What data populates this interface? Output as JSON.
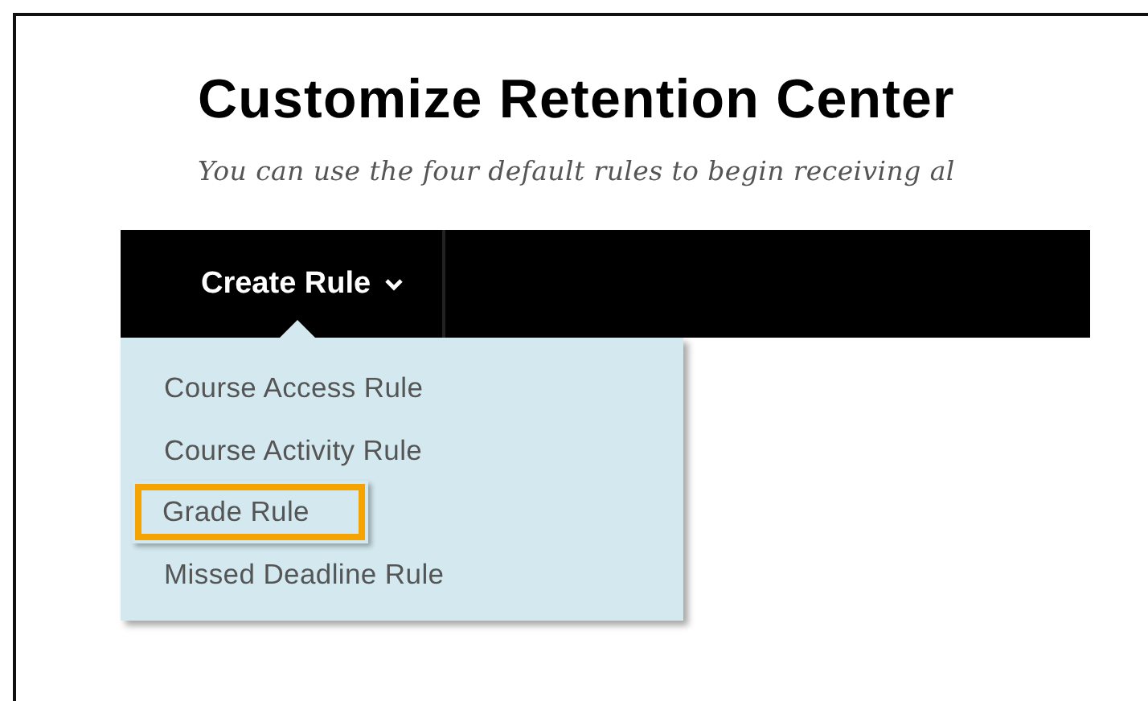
{
  "page": {
    "title": "Customize Retention Center",
    "subtitle": "You can use the four default rules to begin receiving al"
  },
  "toolbar": {
    "menu_button": {
      "label": "Create Rule",
      "expanded": true
    }
  },
  "dropdown": {
    "items": [
      {
        "label": "Course Access Rule",
        "selected": false
      },
      {
        "label": "Course Activity Rule",
        "selected": false
      },
      {
        "label": "Grade Rule",
        "selected": true
      },
      {
        "label": "Missed Deadline Rule",
        "selected": false
      }
    ]
  }
}
